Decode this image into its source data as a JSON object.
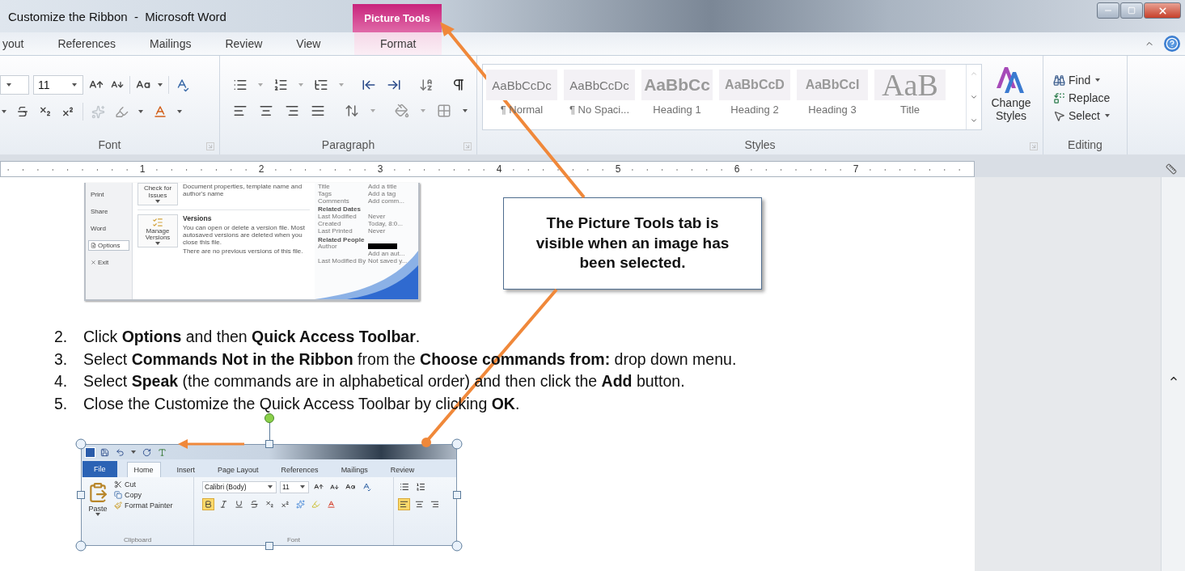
{
  "window": {
    "title": "Customize the Ribbon  -  Microsoft Word"
  },
  "contextual_tab": {
    "group": "Picture Tools"
  },
  "tabs": [
    {
      "label": "yout",
      "kind": "tab"
    },
    {
      "label": "References",
      "kind": "tab"
    },
    {
      "label": "Mailings",
      "kind": "tab"
    },
    {
      "label": "Review",
      "kind": "tab"
    },
    {
      "label": "View",
      "kind": "tab"
    },
    {
      "label": "Format",
      "kind": "contextual"
    }
  ],
  "ribbon": {
    "font": {
      "label": "Font",
      "size": "11"
    },
    "paragraph": {
      "label": "Paragraph"
    },
    "styles": {
      "label": "Styles",
      "change_styles": "Change Styles",
      "items": [
        {
          "preview": "AaBbCcDc",
          "name": "¶ Normal",
          "kind": "body"
        },
        {
          "preview": "AaBbCcDc",
          "name": "¶ No Spaci...",
          "kind": "body"
        },
        {
          "preview": "AaBbCc",
          "name": "Heading 1",
          "kind": "h1"
        },
        {
          "preview": "AaBbCcD",
          "name": "Heading 2",
          "kind": "h2"
        },
        {
          "preview": "AaBbCcI",
          "name": "Heading 3",
          "kind": "h2"
        },
        {
          "preview": "AaB",
          "name": "Title",
          "kind": "title"
        }
      ]
    },
    "editing": {
      "label": "Editing",
      "items": [
        {
          "label": "Find",
          "kind": "find"
        },
        {
          "label": "Replace",
          "kind": "replace"
        },
        {
          "label": "Select",
          "kind": "select"
        }
      ]
    }
  },
  "ruler": {
    "numbers": [
      "1",
      "2",
      "3",
      "4",
      "5",
      "6",
      "7"
    ]
  },
  "backstage": {
    "nav": [
      {
        "label": "Print",
        "kind": "plain",
        "selected": false
      },
      {
        "label": "Share",
        "kind": "plain",
        "selected": false
      },
      {
        "label": "Word",
        "kind": "plain",
        "selected": false
      },
      {
        "label": "Options",
        "kind": "options",
        "selected": true
      },
      {
        "label": "Exit",
        "kind": "exit",
        "selected": false
      }
    ],
    "inspect_button": "Check for Issues",
    "inspect_note": "Document properties, template name and author's name",
    "versions_button": "Manage Versions",
    "versions_title": "Versions",
    "versions_text": "You can open or delete a version file. Most autosaved versions are deleted when you close this file.",
    "versions_note": "There are no previous versions of this file.",
    "properties": [
      {
        "label": "Title",
        "value": "Add a title"
      },
      {
        "label": "Tags",
        "value": "Add a tag"
      },
      {
        "label": "Comments",
        "value": "Add comm..."
      }
    ],
    "dates_heading": "Related Dates",
    "dates": [
      {
        "label": "Last Modified",
        "value": "Never"
      },
      {
        "label": "Created",
        "value": "Today, 8:0..."
      },
      {
        "label": "Last Printed",
        "value": "Never"
      }
    ],
    "people_heading": "Related People",
    "people": [
      {
        "label": "Author",
        "kind": "redacted"
      },
      {
        "value": "Add an aut...",
        "kind": "value_only"
      },
      {
        "label": "Last Modified By",
        "value": "Not saved y...",
        "kind": "pair"
      }
    ]
  },
  "steps": [
    {
      "number": "2.",
      "text": "Click **Options** and then **Quick Access Toolbar**."
    },
    {
      "number": "3.",
      "text": "Select **Commands Not in the Ribbon** from the **Choose commands from:** drop down menu."
    },
    {
      "number": "4.",
      "text": "Select **Speak** (the commands are in alphabetical order) and then click the **Add** button."
    },
    {
      "number": "5.",
      "text": "Close the Customize the Quick Access Toolbar by clicking **OK**."
    }
  ],
  "inset": {
    "tabs": [
      {
        "label": "File",
        "kind": "file",
        "selected": false
      },
      {
        "label": "Home",
        "kind": "tab",
        "selected": true
      },
      {
        "label": "Insert",
        "kind": "tab",
        "selected": false
      },
      {
        "label": "Page Layout",
        "kind": "tab",
        "selected": false
      },
      {
        "label": "References",
        "kind": "tab",
        "selected": false
      },
      {
        "label": "Mailings",
        "kind": "tab",
        "selected": false
      },
      {
        "label": "Review",
        "kind": "tab",
        "selected": false
      }
    ],
    "clipboard": {
      "label": "Clipboard",
      "paste": "Paste",
      "items": [
        {
          "label": "Cut",
          "kind": "cut"
        },
        {
          "label": "Copy",
          "kind": "copy"
        },
        {
          "label": "Format Painter",
          "kind": "painter"
        }
      ]
    },
    "font": {
      "label": "Font",
      "name": "Calibri (Body)",
      "size": "11",
      "bold": true
    },
    "paragraph": {
      "align_left": true
    }
  },
  "callout": {
    "text": "The Picture Tools tab is visible when an image has been selected."
  }
}
